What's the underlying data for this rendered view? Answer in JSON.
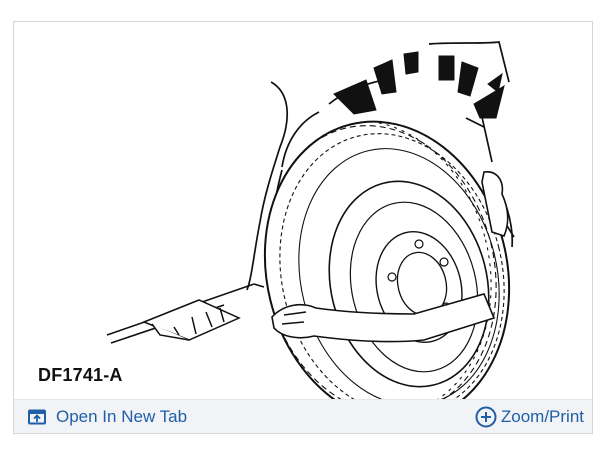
{
  "figure": {
    "label": "DF1741-A",
    "description_icon": "wheel-tire-diagram"
  },
  "toolbar": {
    "open_new_tab_label": "Open In New Tab",
    "open_new_tab_icon": "open-in-new-tab-icon",
    "zoom_print_label": "Zoom/Print",
    "zoom_print_icon": "zoom-plus-icon"
  },
  "colors": {
    "link": "#1f5fa8",
    "toolbar_bg": "#f1f3f6",
    "border": "#d3d6da",
    "ink": "#111111"
  }
}
